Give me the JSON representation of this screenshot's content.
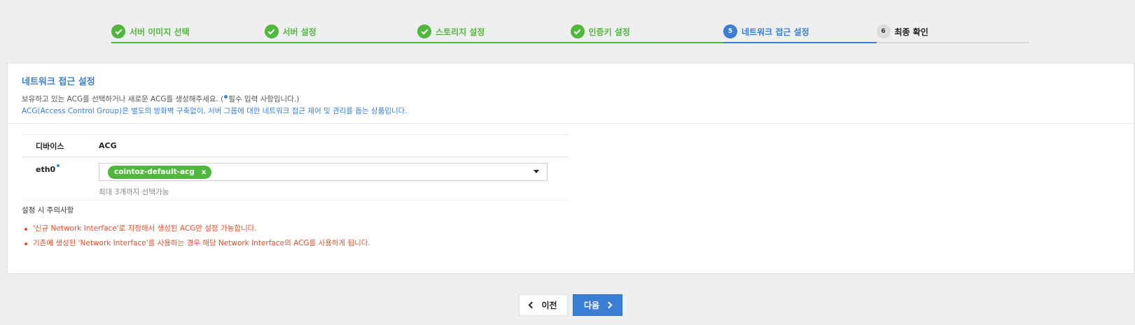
{
  "stepper": {
    "steps": [
      {
        "label": "서버 이미지 선택",
        "state": "done",
        "number": ""
      },
      {
        "label": "서버 설정",
        "state": "done",
        "number": ""
      },
      {
        "label": "스토리지 설정",
        "state": "done",
        "number": ""
      },
      {
        "label": "인증키 설정",
        "state": "done",
        "number": ""
      },
      {
        "label": "네트워크 접근 설정",
        "state": "active",
        "number": "5"
      },
      {
        "label": "최종 확인",
        "state": "pending",
        "number": "6"
      }
    ]
  },
  "panel": {
    "title": "네트워크 접근 설정",
    "desc1_before": "보유하고 있는 ACG를 선택하거나 새로운 ACG를 생성해주세요. (",
    "desc1_after": "필수 입력 사항입니다.)",
    "desc2": "ACG(Access Control Group)은 별도의 방화벽 구축없이, 서버 그룹에 대한 네트워크 접근 제어 및 관리를 돕는 상품입니다."
  },
  "table": {
    "headers": {
      "device": "디바이스",
      "acg": "ACG"
    },
    "rows": [
      {
        "device": "eth0",
        "chip": "cointoz-default-acg",
        "chip_remove": "x",
        "hint": "최대 3개까지 선택가능"
      }
    ]
  },
  "notes": {
    "title": "설정 시 주의사항",
    "items": [
      "'신규 Network Interface'로 지정해서 생성된 ACG만 설정 가능합니다.",
      "기존에 생성된 'Network Interface'를 사용하는 경우 해당 Network Interface의 ACG를 사용하게 됩니다."
    ]
  },
  "buttons": {
    "prev": "이전",
    "next": "다음"
  },
  "colors": {
    "done": "#50b83c",
    "active": "#3a7fd5",
    "warning": "#e04f2a"
  },
  "icons": {
    "done_step": "check-icon",
    "select": "caret-down-icon",
    "prev": "chevron-left-icon",
    "next": "chevron-right-icon"
  }
}
